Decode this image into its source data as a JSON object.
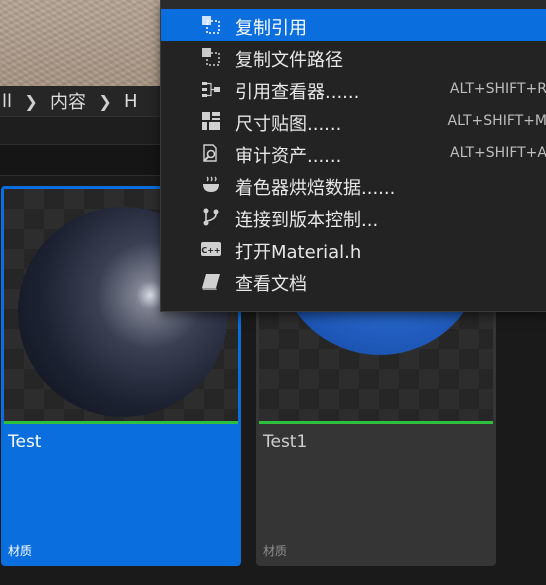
{
  "breadcrumb": {
    "items": [
      "ll",
      "内容",
      "H"
    ]
  },
  "assets": [
    {
      "name": "Test",
      "type": "材质",
      "selected": true,
      "sphere_color": "#1c2131"
    },
    {
      "name": "Test1",
      "type": "材质",
      "selected": false,
      "sphere_color": "#2a6cd0"
    }
  ],
  "context_menu": {
    "items": [
      {
        "label": "复制引用",
        "shortcut": "",
        "icon": "copy-reference-icon",
        "highlighted": true
      },
      {
        "label": "复制文件路径",
        "shortcut": "",
        "icon": "copy-file-path-icon",
        "highlighted": false
      },
      {
        "label": "引用查看器......",
        "shortcut": "ALT+SHIFT+R",
        "icon": "reference-viewer-icon",
        "highlighted": false
      },
      {
        "label": "尺寸贴图......",
        "shortcut": "ALT+SHIFT+M",
        "icon": "size-map-icon",
        "highlighted": false
      },
      {
        "label": "审计资产......",
        "shortcut": "ALT+SHIFT+A",
        "icon": "audit-assets-icon",
        "highlighted": false
      },
      {
        "label": "着色器烘焙数据......",
        "shortcut": "",
        "icon": "shader-cook-icon",
        "highlighted": false
      },
      {
        "label": "连接到版本控制...",
        "shortcut": "",
        "icon": "source-control-icon",
        "highlighted": false
      },
      {
        "label": "打开Material.h",
        "shortcut": "",
        "icon": "cpp-header-icon",
        "highlighted": false
      },
      {
        "label": "查看文档",
        "shortcut": "",
        "icon": "documentation-icon",
        "highlighted": false
      }
    ]
  },
  "colors": {
    "accent": "#0a6ede",
    "asset_underline": "#2fbf3f",
    "menu_bg": "#232323"
  }
}
